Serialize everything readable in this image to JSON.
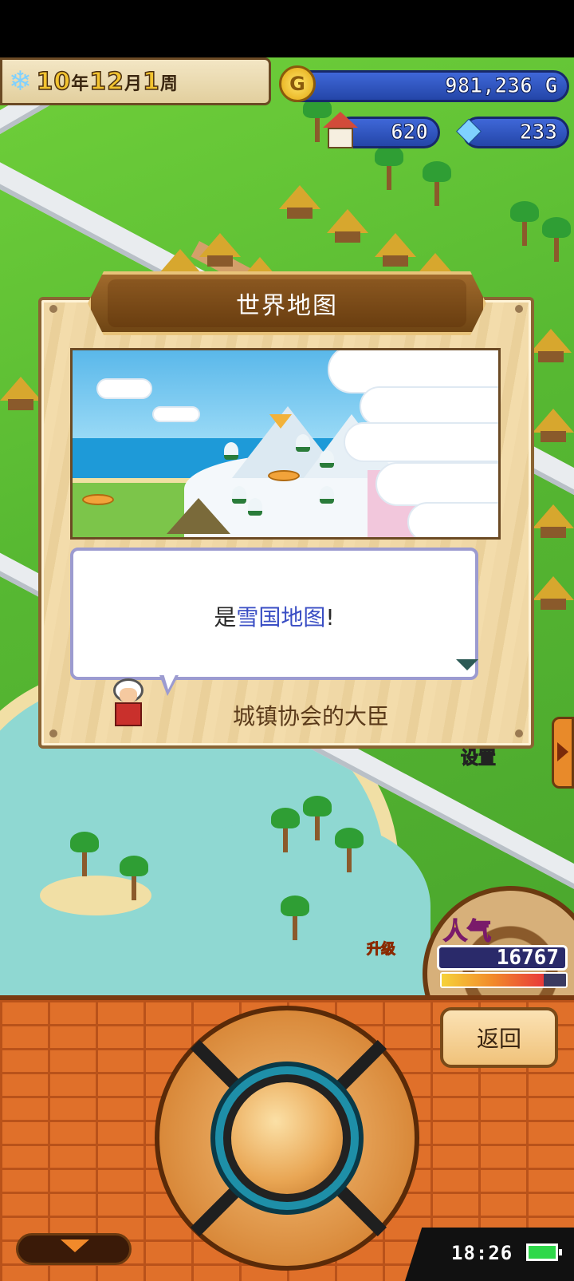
{
  "hud": {
    "date": "10年12月1周",
    "date_parts": {
      "year": "10",
      "year_unit": "年",
      "month": "12",
      "month_unit": "月",
      "week": "1",
      "week_unit": "周"
    },
    "gold": "981,236 G",
    "gold_icon_letter": "G",
    "population": "620",
    "gems": "233",
    "snow_icon": "snowflake-icon"
  },
  "dialog": {
    "title": "世界地图",
    "message_prefix": "是",
    "message_highlight": "雪国地图",
    "message_suffix": "!",
    "speaker": "城镇协会的大臣"
  },
  "world": {
    "sign_text": "设置",
    "level_up": "升级"
  },
  "popularity": {
    "label": "人气",
    "value": "16767",
    "meter_fraction": 0.82
  },
  "bottom": {
    "back_label": "返回",
    "clock": "18:26"
  },
  "colors": {
    "highlight_text": "#3a4ec4",
    "hud_bar": "#2446a8",
    "brick": "#e0702a"
  }
}
